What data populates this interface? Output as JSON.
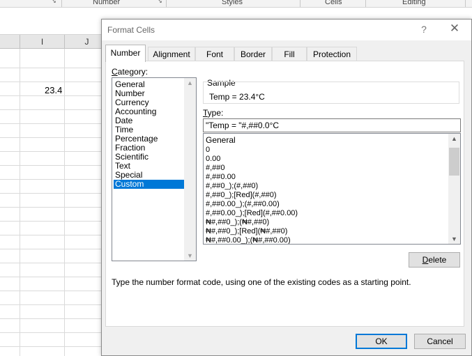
{
  "ribbon": {
    "groups": [
      "Number",
      "Styles",
      "Cells",
      "Editing"
    ],
    "launcher_icon": "dialog-launcher-icon"
  },
  "spreadsheet": {
    "columns": [
      "I",
      "J"
    ],
    "cell_value": "23.4"
  },
  "dialog": {
    "title": "Format Cells",
    "help_glyph": "?",
    "close_glyph": "✕",
    "tabs": [
      {
        "label": "Number",
        "active": true
      },
      {
        "label": "Alignment",
        "active": false
      },
      {
        "label": "Font",
        "active": false
      },
      {
        "label": "Border",
        "active": false
      },
      {
        "label": "Fill",
        "active": false
      },
      {
        "label": "Protection",
        "active": false
      }
    ],
    "category_label": "Category:",
    "category_label_ak": "C",
    "category_label_rest": "ategory:",
    "categories": [
      "General",
      "Number",
      "Currency",
      "Accounting",
      "Date",
      "Time",
      "Percentage",
      "Fraction",
      "Scientific",
      "Text",
      "Special",
      "Custom"
    ],
    "selected_category": "Custom",
    "sample_label": "Sample",
    "sample_value": "Temp = 23.4°C",
    "type_label": "Type:",
    "type_label_ak": "T",
    "type_label_rest": "ype:",
    "type_value": "\"Temp = \"#,##0.0°C",
    "formats": [
      "General",
      "0",
      "0.00",
      "#,##0",
      "#,##0.00",
      "#,##0_);(#,##0)",
      "#,##0_);[Red](#,##0)",
      "#,##0.00_);(#,##0.00)",
      "#,##0.00_);[Red](#,##0.00)",
      "₦#,##0_);(₦#,##0)",
      "₦#,##0_);[Red](₦#,##0)",
      "₦#,##0.00_);(₦#,##0.00)"
    ],
    "delete_label": "Delete",
    "delete_ak": "D",
    "delete_rest": "elete",
    "hint": "Type the number format code, using one of the existing codes as a starting point.",
    "ok_label": "OK",
    "cancel_label": "Cancel",
    "accent_color": "#0078d7"
  }
}
